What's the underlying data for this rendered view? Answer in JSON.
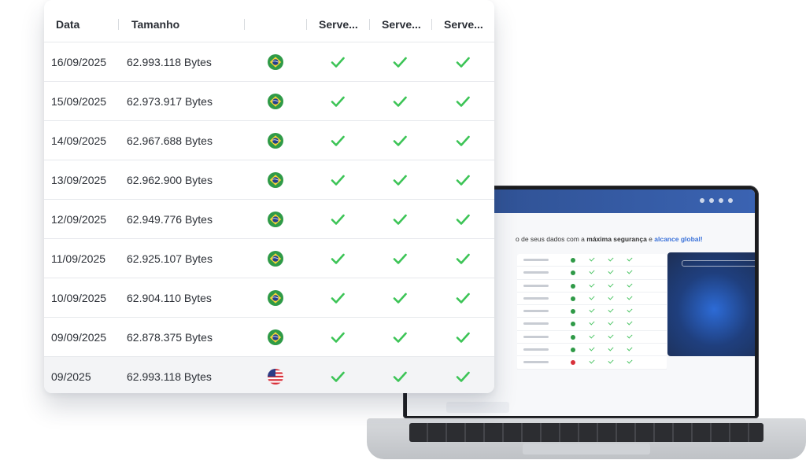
{
  "table": {
    "columns": [
      "Data",
      "Tamanho",
      "",
      "Serve...",
      "Serve...",
      "Serve..."
    ],
    "rows": [
      {
        "date": "16/09/2025",
        "size": "62.993.118 Bytes",
        "flag": "brazil-flag-icon",
        "checks": [
          "check-icon",
          "check-icon",
          "check-icon"
        ]
      },
      {
        "date": "15/09/2025",
        "size": "62.973.917 Bytes",
        "flag": "brazil-flag-icon",
        "checks": [
          "check-icon",
          "check-icon",
          "check-icon"
        ]
      },
      {
        "date": "14/09/2025",
        "size": "62.967.688 Bytes",
        "flag": "brazil-flag-icon",
        "checks": [
          "check-icon",
          "check-icon",
          "check-icon"
        ]
      },
      {
        "date": "13/09/2025",
        "size": "62.962.900 Bytes",
        "flag": "brazil-flag-icon",
        "checks": [
          "check-icon",
          "check-icon",
          "check-icon"
        ]
      },
      {
        "date": "12/09/2025",
        "size": "62.949.776 Bytes",
        "flag": "brazil-flag-icon",
        "checks": [
          "check-icon",
          "check-icon",
          "check-icon"
        ]
      },
      {
        "date": "11/09/2025",
        "size": "62.925.107 Bytes",
        "flag": "brazil-flag-icon",
        "checks": [
          "check-icon",
          "check-icon",
          "check-icon"
        ]
      },
      {
        "date": "10/09/2025",
        "size": "62.904.110 Bytes",
        "flag": "brazil-flag-icon",
        "checks": [
          "check-icon",
          "check-icon",
          "check-icon"
        ]
      },
      {
        "date": "09/09/2025",
        "size": "62.878.375 Bytes",
        "flag": "brazil-flag-icon",
        "checks": [
          "check-icon",
          "check-icon",
          "check-icon"
        ]
      },
      {
        "date": "09/2025",
        "size": "62.993.118 Bytes",
        "flag": "usa-flag-icon",
        "checks": [
          "check-icon",
          "check-icon",
          "check-icon"
        ]
      }
    ]
  },
  "laptop_screen": {
    "headline_part1": "o de seus dados com a ",
    "headline_bold": "máxima segurança",
    "headline_part2": " e ",
    "headline_highlight": "alcance global!"
  },
  "colors": {
    "check": "#3cc456",
    "brazil_green": "#2f9a47",
    "brazil_yellow": "#f5d33b",
    "brazil_blue": "#24408e",
    "usa_red": "#d8303a",
    "usa_blue": "#2b3c86",
    "header_text": "#2b2f36"
  }
}
